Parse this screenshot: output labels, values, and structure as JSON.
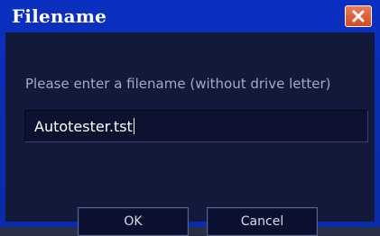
{
  "window": {
    "title": "Filename",
    "close_icon": "close-icon"
  },
  "form": {
    "prompt": "Please enter a filename (without drive letter)",
    "filename_value": "Autotester.tst"
  },
  "buttons": {
    "ok_label": "OK",
    "cancel_label": "Cancel"
  },
  "colors": {
    "titlebar": "#0b2fc0",
    "client_bg": "#13193a",
    "close_button": "#d24a22"
  }
}
